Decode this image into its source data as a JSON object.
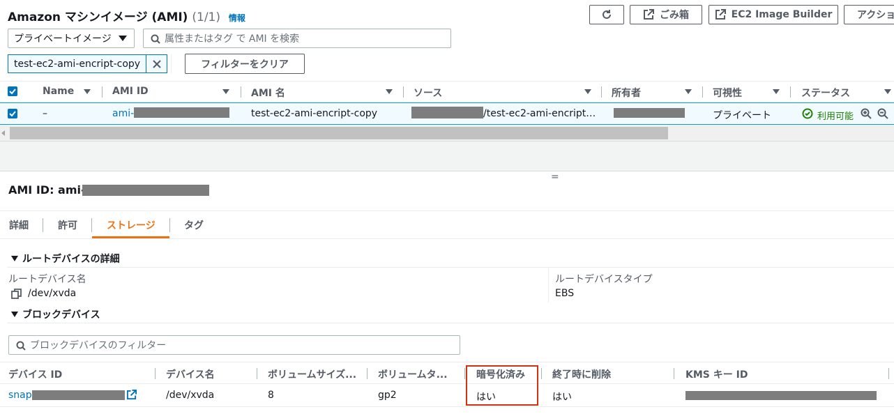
{
  "header": {
    "title": "Amazon マシンイメージ (AMI)",
    "count": "(1/1)",
    "info": "情報",
    "trash_label": "ごみ箱",
    "image_builder_label": "EC2 Image Builder",
    "actions_label": "アクショ"
  },
  "filter": {
    "select_value": "プライベートイメージ",
    "search_placeholder": "属性またはタグ で AMI を検索",
    "token_label": "test-ec2-ami-encript-copy",
    "clear_label": "フィルターをクリア"
  },
  "table": {
    "columns": [
      "Name",
      "AMI ID",
      "AMI 名",
      "ソース",
      "所有者",
      "可視性",
      "ステータス"
    ],
    "row": {
      "name": "–",
      "ami_id_prefix": "ami-0",
      "ami_name": "test-ec2-ami-encript-copy",
      "source_suffix": "/test-ec2-ami-encript…",
      "visibility": "プライベート",
      "status": "利用可能"
    }
  },
  "details": {
    "ami_id_label": "AMI ID: ami-",
    "divider_glyph": "=",
    "tabs": [
      "詳細",
      "許可",
      "ストレージ",
      "タグ"
    ],
    "root_section": "ルートデバイスの詳細",
    "root_name_label": "ルートデバイス名",
    "root_name_value": "/dev/xvda",
    "root_type_label": "ルートデバイスタイプ",
    "root_type_value": "EBS",
    "block_section": "ブロックデバイス",
    "block_filter_placeholder": "ブロックデバイスのフィルター",
    "block_columns": [
      "デバイス ID",
      "デバイス名",
      "ボリュームサイズ...",
      "ボリュームタ...",
      "暗号化済み",
      "終了時に削除",
      "KMS キー ID"
    ],
    "block_row": {
      "device_id_prefix": "snap-",
      "device_name": "/dev/xvda",
      "size": "8",
      "type": "gp2",
      "encrypted": "はい",
      "delete_on_termination": "はい"
    }
  },
  "colors": {
    "link": "#0073bb",
    "accent": "#ec7211",
    "status_green": "#1d8102",
    "highlight_red": "#d13212"
  }
}
